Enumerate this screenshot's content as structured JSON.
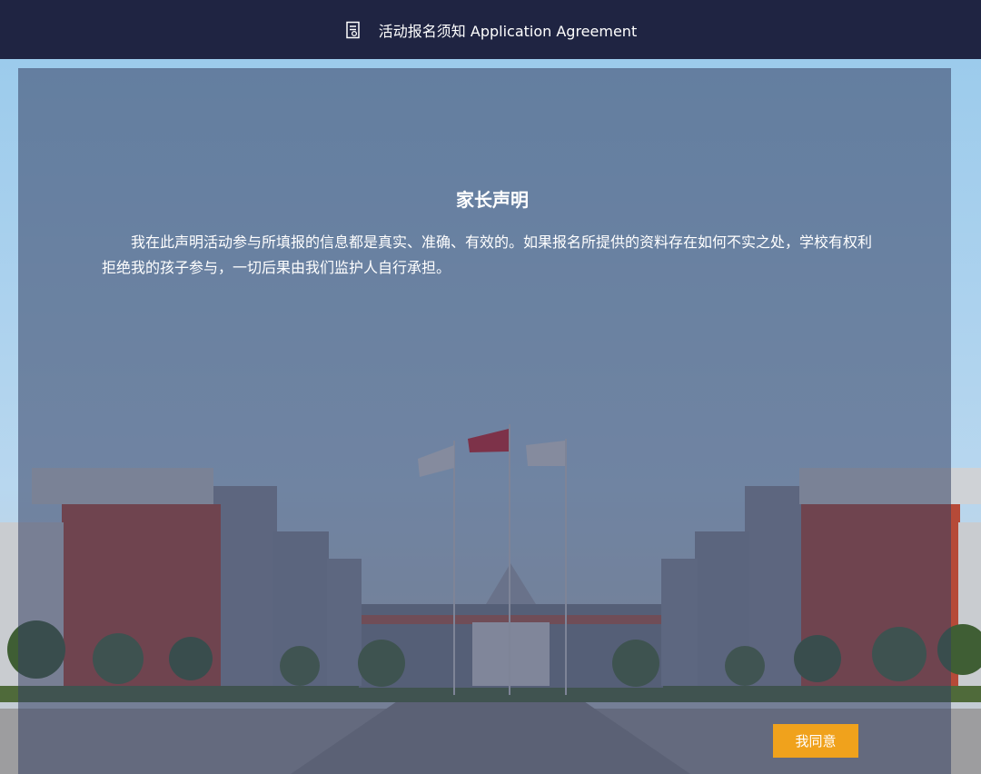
{
  "header": {
    "icon": "document-icon",
    "title": "活动报名须知 Application Agreement"
  },
  "notice": {
    "title": "家长声明",
    "body": "我在此声明活动参与所填报的信息都是真实、准确、有效的。如果报名所提供的资料存在如何不实之处，学校有权利拒绝我的孩子参与，一切后果由我们监护人自行承担。"
  },
  "actions": {
    "agree_label": "我同意"
  },
  "colors": {
    "header_bg": "#1f2442",
    "accent": "#f0a21c",
    "overlay": "#344062"
  }
}
